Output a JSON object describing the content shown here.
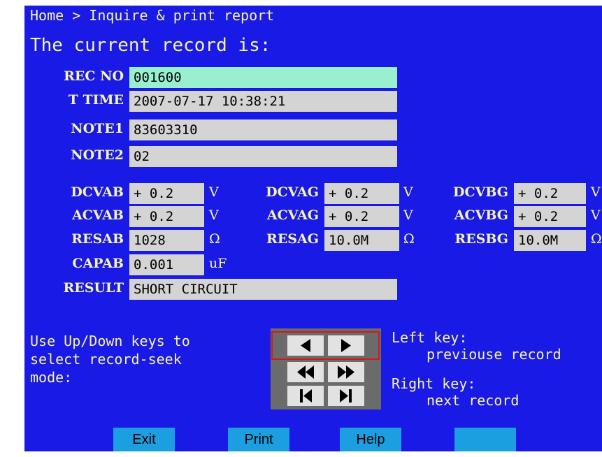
{
  "breadcrumb": "Home > Inquire & print report",
  "current_title": "The current record is:",
  "record": {
    "rec_no": {
      "label": "REC NO",
      "value": "001600"
    },
    "t_time": {
      "label": "T TIME",
      "value": "2007-07-17 10:38:21"
    },
    "note1": {
      "label": "NOTE1",
      "value": "83603310"
    },
    "note2": {
      "label": "NOTE2",
      "value": "02"
    }
  },
  "measurements": {
    "dcvab": {
      "label": "DCVAB",
      "value": "+ 0.2",
      "unit": "V"
    },
    "dcvag": {
      "label": "DCVAG",
      "value": "+ 0.2",
      "unit": "V"
    },
    "dcvbg": {
      "label": "DCVBG",
      "value": "+ 0.2",
      "unit": "V"
    },
    "acvab": {
      "label": "ACVAB",
      "value": "+ 0.2",
      "unit": "V"
    },
    "acvag": {
      "label": "ACVAG",
      "value": "+ 0.2",
      "unit": "V"
    },
    "acvbg": {
      "label": "ACVBG",
      "value": "+ 0.2",
      "unit": "V"
    },
    "resab": {
      "label": "RESAB",
      "value": "1028",
      "unit": "Ω"
    },
    "resag": {
      "label": "RESAG",
      "value": "10.0M",
      "unit": "Ω"
    },
    "resbg": {
      "label": "RESBG",
      "value": "10.0M",
      "unit": "Ω"
    },
    "capab": {
      "label": "CAPAB",
      "value": "0.001",
      "unit": "uF"
    }
  },
  "result": {
    "label": "RESULT",
    "value": "SHORT CIRCUIT"
  },
  "help": {
    "line1": "Use Up/Down keys to",
    "line2": "select record-seek",
    "line3": "mode:",
    "left_key": "Left key:",
    "left_desc": "previouse record",
    "right_key": "Right key:",
    "right_desc": "next record"
  },
  "nav_icons": [
    "prev-arrow-icon",
    "next-arrow-icon",
    "rewind-icon",
    "fast-forward-icon",
    "first-record-icon",
    "last-record-icon"
  ],
  "function_keys": {
    "exit": "Exit",
    "print": "Print",
    "help": "Help",
    "blank": ""
  },
  "colors": {
    "background": "#1a1ae6",
    "label_text": "#f4f4a8",
    "field_bg": "#d4d4d4",
    "selected_field_bg": "#99f0cf",
    "function_key_bg": "#1c9fe0",
    "nav_panel_bg": "#6b6b6b",
    "nav_selection": "#d01a1a"
  }
}
